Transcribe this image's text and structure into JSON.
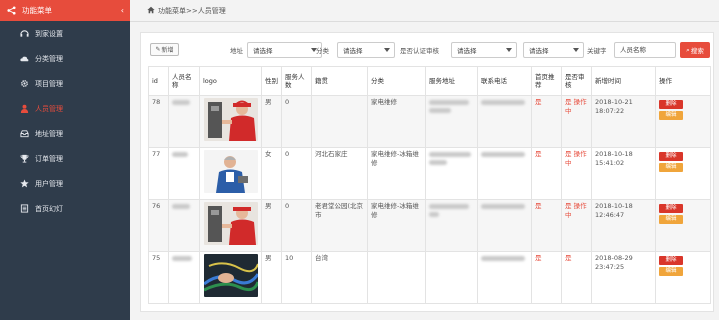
{
  "sidebar": {
    "header": "功能菜单",
    "items": [
      {
        "label": "到家设置",
        "icon": "headset-icon",
        "active": false
      },
      {
        "label": "分类管理",
        "icon": "cloud-icon",
        "active": false
      },
      {
        "label": "项目管理",
        "icon": "gear-icon",
        "active": false
      },
      {
        "label": "人员管理",
        "icon": "user-icon",
        "active": true
      },
      {
        "label": "地址管理",
        "icon": "inbox-icon",
        "active": false
      },
      {
        "label": "订单管理",
        "icon": "trophy-icon",
        "active": false
      },
      {
        "label": "用户管理",
        "icon": "star-icon",
        "active": false
      },
      {
        "label": "首页幻灯",
        "icon": "doc-icon",
        "active": false
      }
    ]
  },
  "breadcrumb": {
    "text": "功能菜单>>人员管理"
  },
  "filters": {
    "add_label": "新增",
    "address_label": "地址",
    "address_value": "请选择",
    "category_label": "分类",
    "category_value": "请选择",
    "certified_label": "是否认证审核",
    "certified_value": "请选择",
    "audit_value": "请选择",
    "keyword_label": "关键字",
    "keyword_placeholder": "人员名称",
    "search_label": "搜索"
  },
  "table": {
    "headers": [
      "id",
      "人员名称",
      "logo",
      "性别",
      "服务人数",
      "籍贯",
      "分类",
      "服务地址",
      "联系电话",
      "首页推荐",
      "是否审核",
      "新增时间",
      "操作"
    ],
    "rows": [
      {
        "id": "78",
        "gender": "男",
        "served": "0",
        "origin": "",
        "category": "家电维修",
        "recommend": "是",
        "audit": "是 操作中",
        "time": "2018-10-21 18:07:22",
        "del": "删除",
        "edit": "编辑"
      },
      {
        "id": "77",
        "gender": "女",
        "served": "0",
        "origin": "河北石家庄",
        "category": "家电维修-冰箱维修",
        "recommend": "是",
        "audit": "是 操作中",
        "time": "2018-10-18 15:41:02",
        "del": "删除",
        "edit": "编辑"
      },
      {
        "id": "76",
        "gender": "男",
        "served": "0",
        "origin": "老君堂公园(北京市",
        "category": "家电维修-冰箱维修",
        "recommend": "是",
        "audit": "是 操作中",
        "time": "2018-10-18 12:46:47",
        "del": "删除",
        "edit": "编辑"
      },
      {
        "id": "75",
        "gender": "男",
        "served": "10",
        "origin": "台湾",
        "category": "",
        "recommend": "是",
        "audit": "是",
        "time": "2018-08-29 23:47:25",
        "del": "删除",
        "edit": "编辑"
      }
    ]
  },
  "colors": {
    "accent": "#e74c3c",
    "sidebar_bg": "#2f3c4b",
    "edit": "#f0a53b"
  }
}
